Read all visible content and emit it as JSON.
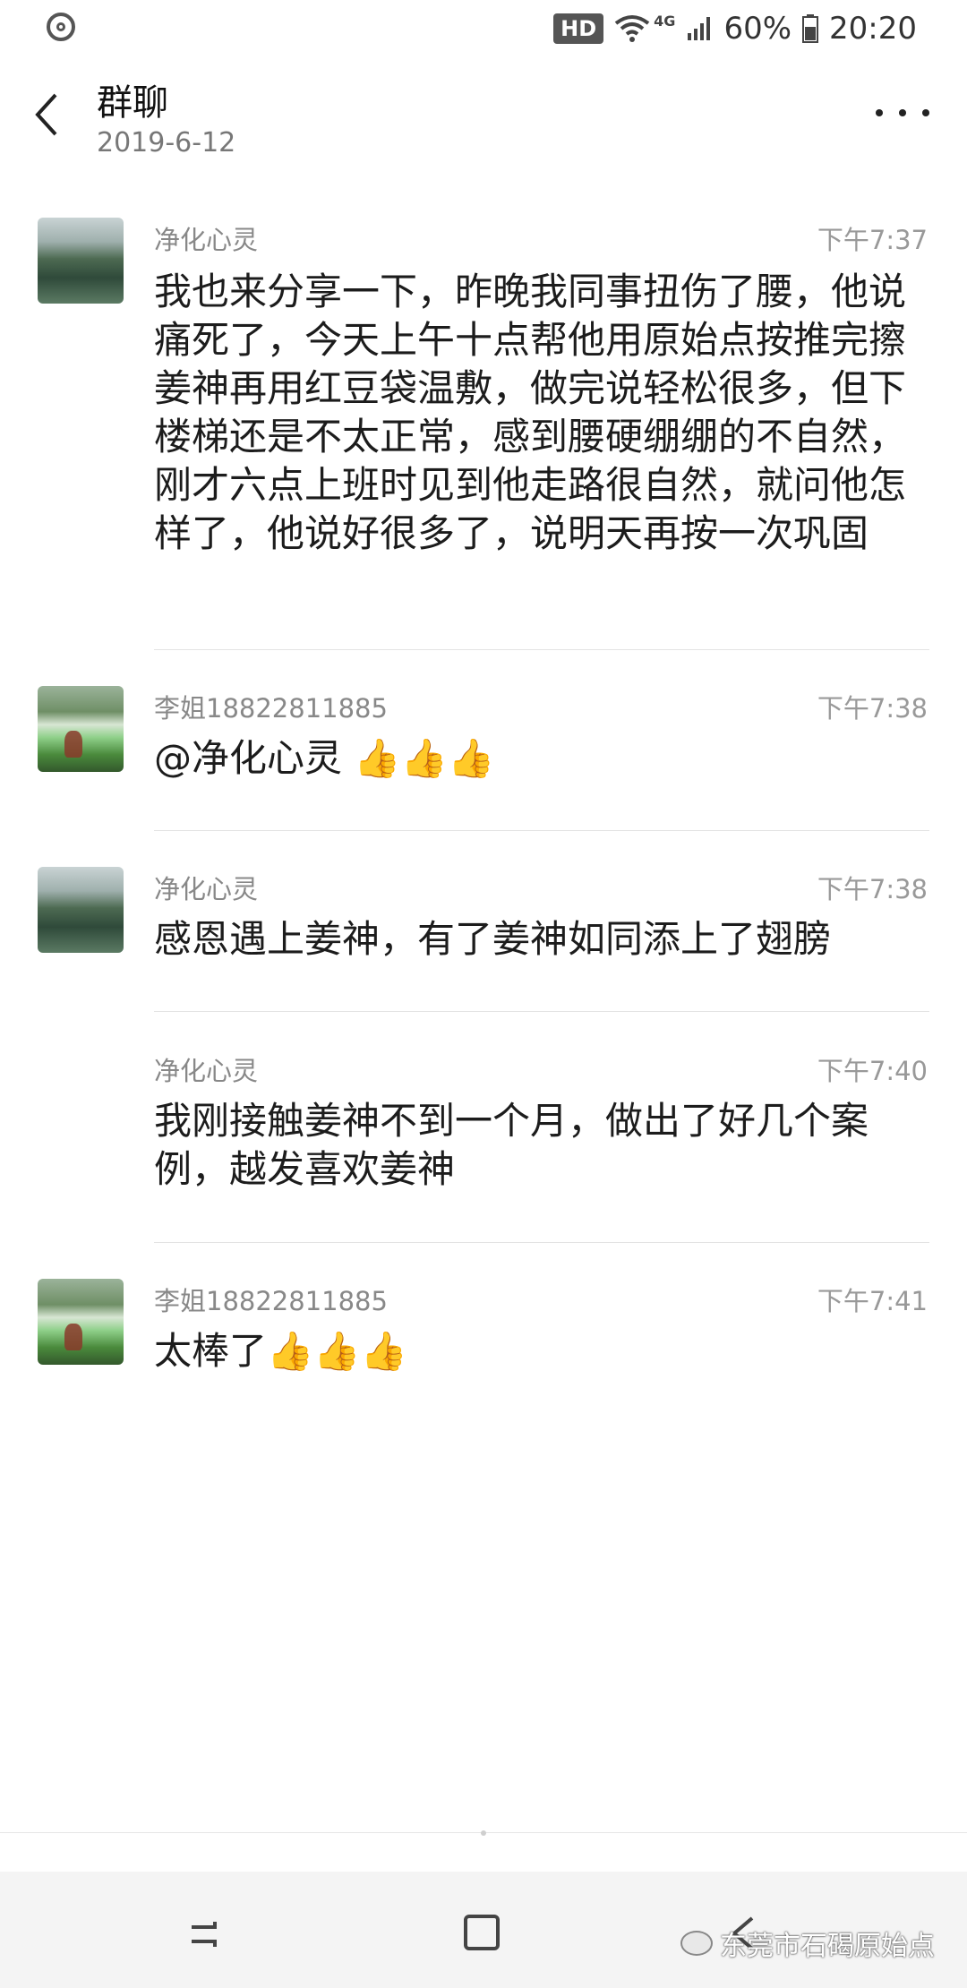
{
  "status_bar": {
    "hd": "HD",
    "net": "4G",
    "battery": "60%",
    "time": "20:20"
  },
  "header": {
    "title": "群聊",
    "date": "2019-6-12"
  },
  "messages": [
    {
      "sender": "净化心灵",
      "time": "下午7:37",
      "text": "我也来分享一下，昨晚我同事扭伤了腰，他说痛死了，今天上午十点帮他用原始点按推完擦姜神再用红豆袋温敷，做完说轻松很多，但下楼梯还是不太正常，感到腰硬绷绷的不自然，刚才六点上班时见到他走路很自然，就问他怎样了，他说好很多了，说明天再按一次巩固",
      "avatar": "lake"
    },
    {
      "sender": "李姐18822811885",
      "time": "下午7:38",
      "text": "@净化心灵 👍👍👍",
      "avatar": "falls"
    },
    {
      "sender": "净化心灵",
      "time": "下午7:38",
      "text": "感恩遇上姜神，有了姜神如同添上了翅膀",
      "avatar": "lake"
    },
    {
      "sender": "净化心灵",
      "time": "下午7:40",
      "text": "我刚接触姜神不到一个月，做出了好几个案例，越发喜欢姜神",
      "avatar": "none"
    },
    {
      "sender": "李姐18822811885",
      "time": "下午7:41",
      "text": "太棒了👍👍👍",
      "avatar": "falls"
    }
  ],
  "watermark": "东莞市石碣原始点",
  "icons": [
    "app-status-icon",
    "wifi-icon",
    "signal-icon",
    "battery-icon",
    "back-arrow-icon",
    "more-icon",
    "recent-apps-icon",
    "home-icon",
    "nav-back-icon",
    "wechat-icon"
  ]
}
